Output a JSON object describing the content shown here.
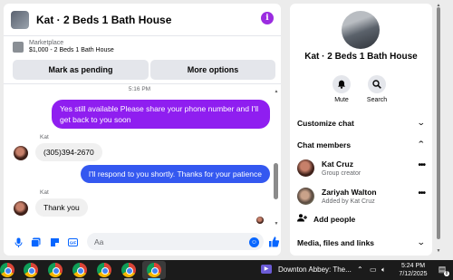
{
  "chat": {
    "title": "Kat · 2 Beds 1 Bath House",
    "info_icon": "i",
    "listing": {
      "category": "Marketplace",
      "name": "$1,000 - 2 Beds 1 Bath House"
    },
    "actions": {
      "mark_pending": "Mark as pending",
      "more_options": "More options"
    },
    "timestamp": "5:16 PM",
    "messages": [
      {
        "direction": "out",
        "text": "Yes still available Please share your phone number and I'll get back to you soon",
        "color": "#8f1ef0"
      },
      {
        "direction": "in",
        "sender": "Kat",
        "text": "(305)394-2670"
      },
      {
        "direction": "out",
        "text": "I'll respond to you shortly. Thanks for your patience",
        "color": "#3458f0"
      },
      {
        "direction": "in",
        "sender": "Kat",
        "text": "Thank you"
      }
    ],
    "composer": {
      "placeholder": "Aa",
      "value": ""
    }
  },
  "info": {
    "title": "Kat · 2 Beds 1 Bath House",
    "mute_label": "Mute",
    "search_label": "Search",
    "customize_chat": "Customize chat",
    "chat_members": "Chat members",
    "members": [
      {
        "name": "Kat Cruz",
        "role": "Group creator"
      },
      {
        "name": "Zariyah Walton",
        "role": "Added by Kat Cruz"
      }
    ],
    "add_people": "Add people",
    "media_files_links": "Media, files and links"
  },
  "taskbar": {
    "media_title": "Downton Abbey: The...",
    "time": "5:24 PM",
    "date": "7/12/2025",
    "notification_count": "8"
  },
  "colors": {
    "accent": "#0866ff",
    "outgoing_purple": "#8f1ef0",
    "outgoing_blue": "#3458f0",
    "info_purple": "#9b2ce0"
  }
}
